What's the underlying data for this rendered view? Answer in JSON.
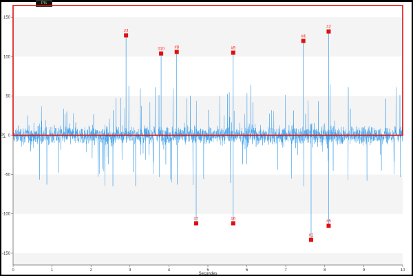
{
  "window": {
    "tab_label": "Pts"
  },
  "chart_data": {
    "type": "line",
    "xlabel": "Secondes",
    "ylabel": "µV",
    "xlim": [
      0,
      10
    ],
    "ylim": [
      -165,
      165
    ],
    "x_ticks": [
      0,
      1,
      2,
      3,
      4,
      5,
      6,
      7,
      8,
      9,
      10
    ],
    "y_ticks": [
      -150,
      -100,
      -50,
      0,
      50,
      100,
      150
    ],
    "grid": "alternating horizontal bands",
    "signal_color": "#3a9be8",
    "marker_color": "#e01010",
    "selection_box": {
      "x": [
        0,
        10
      ],
      "y": [
        0,
        165
      ],
      "color": "#e01010"
    },
    "series": [
      {
        "values": [
          {
            "x": 2.9,
            "y": 127
          },
          {
            "x": 3.8,
            "y": 104
          },
          {
            "x": 4.2,
            "y": 106
          },
          {
            "x": 5.65,
            "y": 105
          },
          {
            "x": 7.45,
            "y": 120
          },
          {
            "x": 8.1,
            "y": 132
          },
          {
            "x": 4.7,
            "y": -112
          },
          {
            "x": 5.65,
            "y": -112
          },
          {
            "x": 7.65,
            "y": -133
          },
          {
            "x": 8.1,
            "y": -115
          }
        ]
      }
    ],
    "markers": [
      {
        "label": "#3",
        "x": 2.9,
        "y": 127
      },
      {
        "label": "#10",
        "x": 3.8,
        "y": 104
      },
      {
        "label": "#8",
        "x": 4.2,
        "y": 106
      },
      {
        "label": "#9",
        "x": 5.65,
        "y": 105
      },
      {
        "label": "#4",
        "x": 7.45,
        "y": 120
      },
      {
        "label": "#2",
        "x": 8.1,
        "y": 132
      },
      {
        "label": "#7",
        "x": 4.7,
        "y": -112
      },
      {
        "label": "#6",
        "x": 5.65,
        "y": -112
      },
      {
        "label": "#1",
        "x": 7.65,
        "y": -133
      },
      {
        "label": "#5",
        "x": 8.1,
        "y": -115
      }
    ]
  }
}
